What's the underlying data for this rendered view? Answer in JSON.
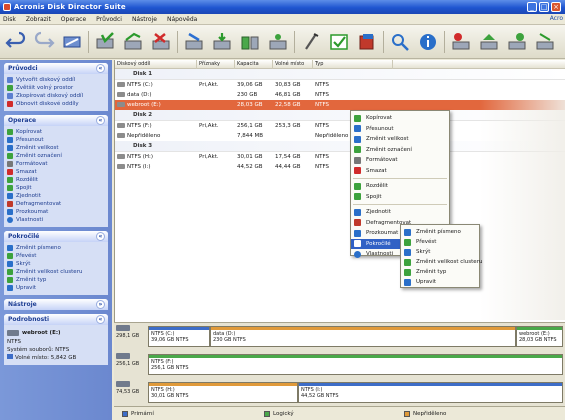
{
  "window": {
    "title": "Acronis Disk Director Suite",
    "min": "_",
    "max": "□",
    "close": "×"
  },
  "menu": {
    "items": [
      "Disk",
      "Zobrazit",
      "Operace",
      "Průvodci",
      "Nástroje",
      "Nápověda"
    ],
    "help_link": "Acro"
  },
  "toolbar": {
    "icons": [
      "undo-icon",
      "redo-icon",
      "commit-icon",
      "check-disk-icon",
      "copy-icon",
      "delete-icon",
      "resize-icon",
      "convert-icon",
      "split-icon",
      "merge-icon",
      "format-icon",
      "hide-icon",
      "explore-icon",
      "info-icon",
      "wizard-icon",
      "recovery-icon",
      "settings-icon",
      "wizard2-icon"
    ]
  },
  "sidebar": {
    "pruvodci": {
      "title": "Průvodci",
      "items": [
        "Vytvořit diskový oddíl",
        "Zvětšit volný prostor",
        "Zkopírovat diskový oddíl",
        "Obnovit diskové oddíly"
      ]
    },
    "operace": {
      "title": "Operace",
      "items": [
        "Kopírovat",
        "Přesunout",
        "Změnit velikost",
        "Změnit označení",
        "Formátovat",
        "Smazat",
        "Rozdělit",
        "Spojit",
        "Zjednotit",
        "Defragmentovat",
        "Prozkoumat",
        "Vlastnosti"
      ]
    },
    "pokrocile": {
      "title": "Pokročilé",
      "items": [
        "Změnit písmeno",
        "Převést",
        "Skrýt",
        "Změnit velikost clusteru",
        "Změnit typ",
        "Upravit"
      ]
    },
    "nastroje": {
      "title": "Nástroje"
    },
    "podrobnosti": {
      "title": "Podrobnosti",
      "drive": "webroot (E:)",
      "fs": "NTFS",
      "fs_label": "Systém souborů: NTFS",
      "free_label": "Volné místo:",
      "free_value": "5,842 GB"
    }
  },
  "table": {
    "columns": [
      "Diskový oddíl",
      "Příznaky",
      "Kapacita",
      "Volné místo",
      "Typ"
    ],
    "groups": [
      {
        "label": "Disk 1",
        "rows": [
          {
            "name": "NTFS (C:)",
            "flags": "Pri,Akt.",
            "cap": "39,06 GB",
            "free": "30,83 GB",
            "type": "NTFS"
          },
          {
            "name": "data (D:)",
            "flags": "",
            "cap": "230 GB",
            "free": "46,81 GB",
            "type": "NTFS"
          },
          {
            "name": "webroot (E:)",
            "flags": "",
            "cap": "28,03 GB",
            "free": "22,58 GB",
            "type": "NTFS",
            "selected": true
          }
        ]
      },
      {
        "label": "Disk 2",
        "rows": [
          {
            "name": "NTFS (F:)",
            "flags": "Pri,Akt.",
            "cap": "256,1 GB",
            "free": "253,3 GB",
            "type": "NTFS"
          },
          {
            "name": "Nepřiděleno",
            "flags": "",
            "cap": "7,844 MB",
            "free": "",
            "type": "Nepřiděleno"
          }
        ]
      },
      {
        "label": "Disk 3",
        "rows": [
          {
            "name": "NTFS (H:)",
            "flags": "Pri,Akt.",
            "cap": "30,01 GB",
            "free": "17,54 GB",
            "type": "NTFS"
          },
          {
            "name": "NTFS (I:)",
            "flags": "",
            "cap": "44,52 GB",
            "free": "44,44 GB",
            "type": "NTFS"
          }
        ]
      }
    ]
  },
  "context_menu": {
    "items": [
      "Kopírovat",
      "Přesunout",
      "Změnit velikost",
      "Změnit označení",
      "Formátovat",
      "Smazat",
      "Rozdělit",
      "Spojit",
      "Zjednotit",
      "Defragmentovat",
      "Prozkoumat",
      "Pokročilé",
      "Vlastnosti"
    ],
    "highlighted": "Pokročilé"
  },
  "submenu": {
    "items": [
      "Změnit písmeno",
      "Převést",
      "Skrýt",
      "Změnit velikost clusteru",
      "Změnit typ",
      "Upravit"
    ]
  },
  "diskmap": {
    "rows": [
      {
        "size": "298,1 GB",
        "parts": [
          {
            "label": "NTFS (C:)",
            "sub": "39,06 GB NTFS"
          },
          {
            "label": "data (D:)",
            "sub": "230 GB NTFS"
          },
          {
            "label": "webroot (E:)",
            "sub": "28,03 GB NTFS"
          }
        ]
      },
      {
        "size": "256,1 GB",
        "parts": [
          {
            "label": "NTFS (F:)",
            "sub": "256,1 GB NTFS"
          }
        ]
      },
      {
        "size": "74,53 GB",
        "parts": [
          {
            "label": "NTFS (H:)",
            "sub": "30,01 GB NTFS"
          },
          {
            "label": "NTFS (I:)",
            "sub": "44,52 GB NTFS"
          }
        ]
      }
    ]
  },
  "legend": {
    "items": [
      "Primární",
      "Logický",
      "Nepřiděleno"
    ],
    "colors": [
      "#3d6dc8",
      "#4aa84a",
      "#e09a3a"
    ]
  }
}
